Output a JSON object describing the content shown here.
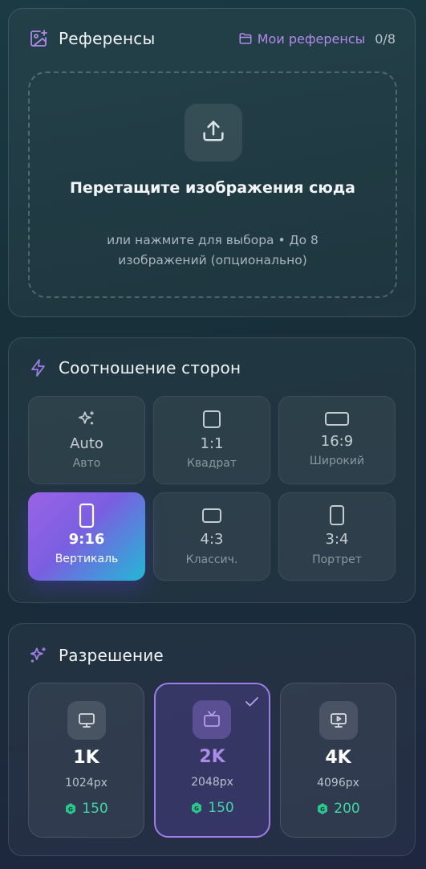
{
  "references": {
    "title": "Референсы",
    "my_refs_label": "Мои референсы",
    "count": "0/8",
    "dropzone": {
      "title": "Перетащите изображения сюда",
      "subtitle": "или нажмите для выбора • До 8 изображений (опционально)"
    }
  },
  "aspect": {
    "title": "Соотношение сторон",
    "selected": "9:16",
    "options": [
      {
        "ratio": "Auto",
        "desc": "Авто",
        "icon": "sparkle-icon"
      },
      {
        "ratio": "1:1",
        "desc": "Квадрат",
        "icon": "square-icon"
      },
      {
        "ratio": "16:9",
        "desc": "Широкий",
        "icon": "wide-rect-icon"
      },
      {
        "ratio": "9:16",
        "desc": "Вертикаль",
        "icon": "phone-icon"
      },
      {
        "ratio": "4:3",
        "desc": "Классич.",
        "icon": "rect-icon"
      },
      {
        "ratio": "3:4",
        "desc": "Портрет",
        "icon": "portrait-rect-icon"
      }
    ]
  },
  "resolution": {
    "title": "Разрешение",
    "selected": "2K",
    "options": [
      {
        "name": "1K",
        "px": "1024px",
        "price": "150",
        "icon": "monitor-icon"
      },
      {
        "name": "2K",
        "px": "2048px",
        "price": "150",
        "icon": "tv-icon"
      },
      {
        "name": "4K",
        "px": "4096px",
        "price": "200",
        "icon": "monitor-play-icon"
      }
    ]
  },
  "colors": {
    "accent": "#9d7ee8",
    "price": "#3fd9a4",
    "gradient_start": "#9b63e6",
    "gradient_end": "#22b8d6"
  }
}
